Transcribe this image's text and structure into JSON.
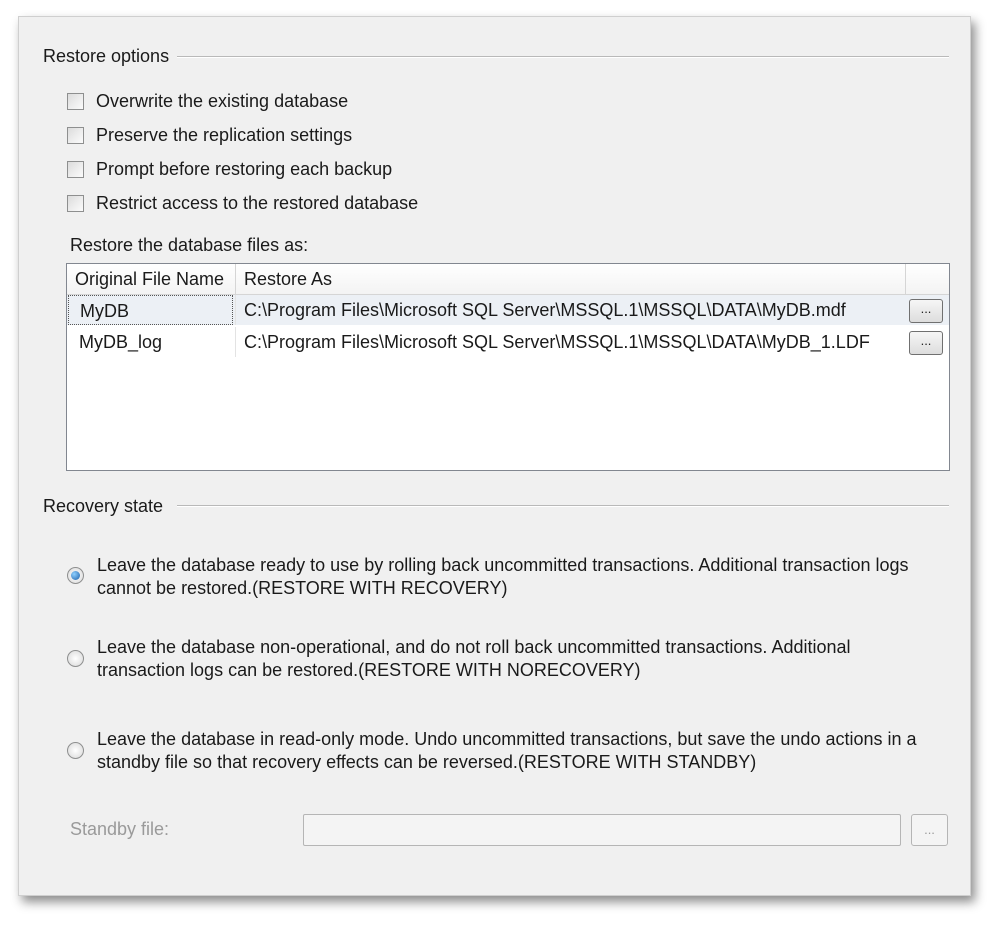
{
  "restore_options": {
    "title": "Restore options",
    "checkboxes": [
      {
        "label": "Overwrite the existing database",
        "checked": false
      },
      {
        "label": "Preserve the replication settings",
        "checked": false
      },
      {
        "label": "Prompt before restoring each backup",
        "checked": false
      },
      {
        "label": "Restrict access to the restored database",
        "checked": false
      }
    ],
    "files_label": "Restore the database files as:",
    "columns": [
      "Original File Name",
      "Restore As"
    ],
    "rows": [
      {
        "name": "MyDB",
        "path": "C:\\Program Files\\Microsoft SQL Server\\MSSQL.1\\MSSQL\\DATA\\MyDB.mdf",
        "button": "..."
      },
      {
        "name": "MyDB_log",
        "path": "C:\\Program Files\\Microsoft SQL Server\\MSSQL.1\\MSSQL\\DATA\\MyDB_1.LDF",
        "button": "..."
      }
    ]
  },
  "recovery_state": {
    "title": "Recovery state",
    "options": [
      {
        "label": "Leave the database ready to use by rolling back uncommitted transactions. Additional transaction logs cannot be restored.(RESTORE WITH RECOVERY)",
        "selected": true
      },
      {
        "label": "Leave the database non-operational, and do not roll back uncommitted transactions. Additional transaction logs can be restored.(RESTORE WITH NORECOVERY)",
        "selected": false
      },
      {
        "label": "Leave the database in read-only mode. Undo uncommitted transactions, but save the undo actions in a standby file so that recovery effects can be reversed.(RESTORE WITH STANDBY)",
        "selected": false
      }
    ],
    "standby_label": "Standby file:",
    "standby_value": "",
    "standby_button": "..."
  }
}
